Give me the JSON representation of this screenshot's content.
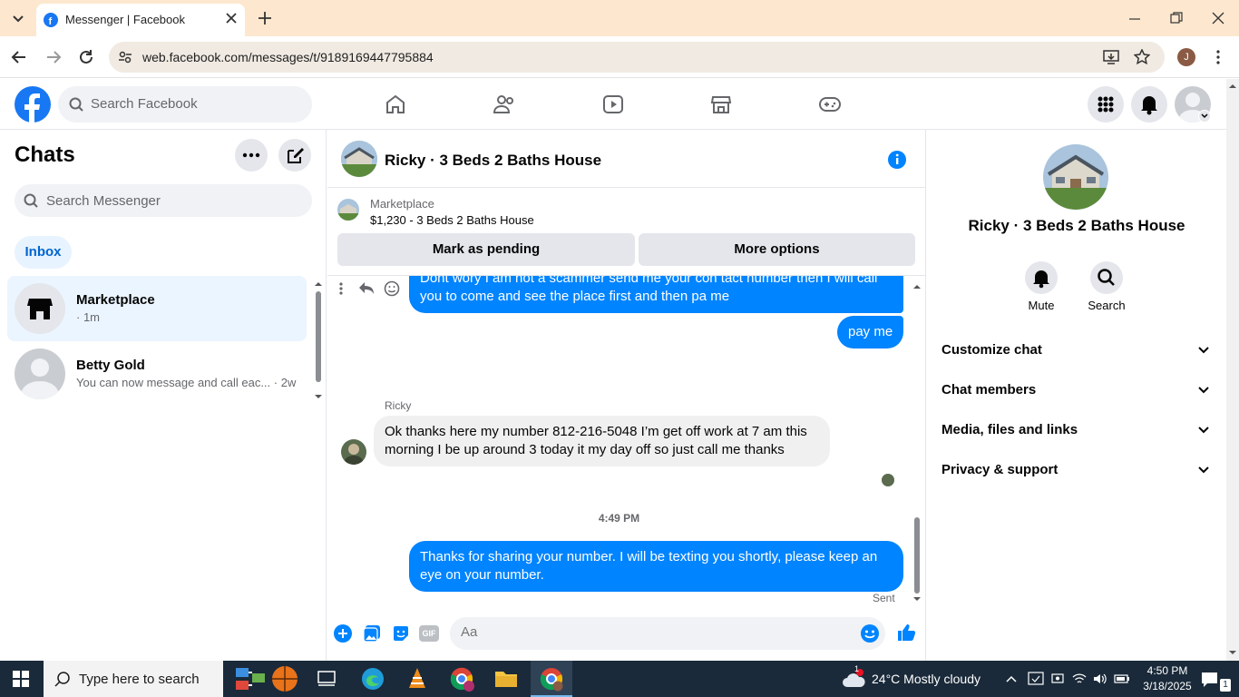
{
  "browser": {
    "tab_title": "Messenger | Facebook",
    "url": "web.facebook.com/messages/t/9189169447795884",
    "profile_initial": "J"
  },
  "facebook": {
    "search_placeholder": "Search Facebook"
  },
  "left": {
    "title": "Chats",
    "search_placeholder": "Search Messenger",
    "inbox_label": "Inbox",
    "conversations": [
      {
        "name": "Marketplace",
        "sub": "· 1m"
      },
      {
        "name": "Betty Gold",
        "sub": "You can now message and call eac... · 2w"
      }
    ]
  },
  "chat": {
    "title": "Ricky · 3 Beds 2 Baths House",
    "marketplace_label": "Marketplace",
    "listing": "$1,230 - 3 Beds 2 Baths House",
    "mark_pending": "Mark as pending",
    "more_options": "More options",
    "messages": {
      "out1": "Dont wory  I am not a scammer send me your con tact number then I will call you to come and see the place first and then pa me",
      "out2": "pay me",
      "sender": "Ricky",
      "in1": "Ok thanks here my number 812-216-5048 I’m get off work at 7 am this morning I be up around 3 today it my day off so just call me thanks",
      "time": "4:49 PM",
      "out3": "Thanks for sharing your number. I will be texting you shortly, please keep an eye on your number.",
      "status": "Sent"
    },
    "composer_placeholder": "Aa",
    "gif_label": "GIF"
  },
  "right": {
    "name": "Ricky · 3 Beds 2 Baths House",
    "mute": "Mute",
    "search": "Search",
    "sections": [
      "Customize chat",
      "Chat members",
      "Media, files and links",
      "Privacy & support"
    ]
  },
  "taskbar": {
    "search_placeholder": "Type here to search",
    "weather": "24°C  Mostly cloudy",
    "time": "4:50 PM",
    "date": "3/18/2025",
    "notif_count": "1",
    "weather_badge": "1"
  },
  "colors": {
    "accent": "#0084ff",
    "fb_blue": "#1877f2"
  }
}
